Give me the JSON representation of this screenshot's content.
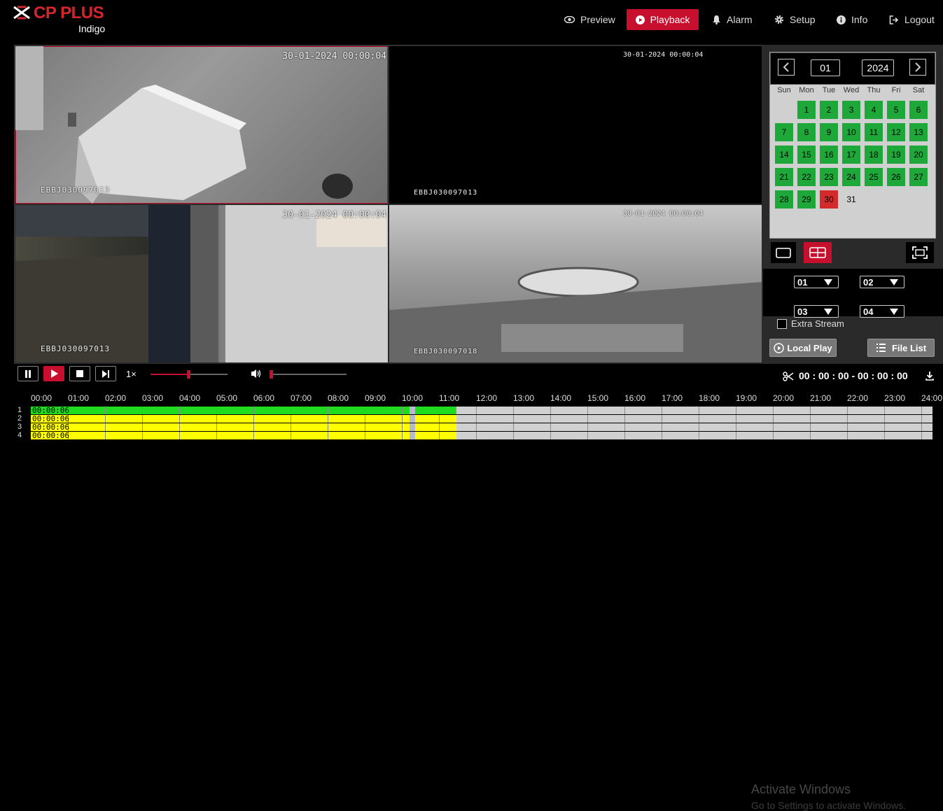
{
  "brand": {
    "name": "CP PLUS",
    "sub": "Indigo",
    "color": "#d6252f"
  },
  "nav": [
    {
      "label": "Preview",
      "icon": "eye-icon"
    },
    {
      "label": "Playback",
      "icon": "play-circle-icon",
      "active": true
    },
    {
      "label": "Alarm",
      "icon": "bell-icon"
    },
    {
      "label": "Setup",
      "icon": "gear-icon"
    },
    {
      "label": "Info",
      "icon": "info-icon"
    },
    {
      "label": "Logout",
      "icon": "logout-icon"
    }
  ],
  "tiles": [
    {
      "timestamp": "30-01-2024 00:00:04",
      "name": "EBBJ030097013",
      "selected": true
    },
    {
      "timestamp": "30-01-2024 00:00:04",
      "name": "EBBJ030097013"
    },
    {
      "timestamp": "30-01-2024 00:00:04",
      "name": "EBBJ030097013"
    },
    {
      "timestamp": "30-01-2024 00:00:04",
      "name": "EBBJ030097018"
    }
  ],
  "calendar": {
    "month": "01",
    "year": "2024",
    "weekdays": [
      "Sun",
      "Mon",
      "Tue",
      "Wed",
      "Thu",
      "Fri",
      "Sat"
    ],
    "days": [
      "1",
      "2",
      "3",
      "4",
      "5",
      "6",
      "7",
      "8",
      "9",
      "10",
      "11",
      "12",
      "13",
      "14",
      "15",
      "16",
      "17",
      "18",
      "19",
      "20",
      "21",
      "22",
      "23",
      "24",
      "25",
      "26",
      "27",
      "28",
      "29",
      "30",
      "31"
    ],
    "recorded_days": 29,
    "selected_day": "30",
    "colors": {
      "recorded": "#1fa83a",
      "selected": "#d32b2b"
    }
  },
  "channels": {
    "ch1": "01",
    "ch2": "02",
    "ch3": "03",
    "ch4": "04"
  },
  "extra_stream": {
    "label": "Extra Stream",
    "checked": false
  },
  "buttons": {
    "local_play": "Local Play",
    "file_list": "File List"
  },
  "controls": {
    "speed": "1×",
    "clip_time": "00 : 00 : 00 - 00 : 00 : 00"
  },
  "timeline": {
    "hours": [
      "00:00",
      "01:00",
      "02:00",
      "03:00",
      "04:00",
      "05:00",
      "06:00",
      "07:00",
      "08:00",
      "09:00",
      "10:00",
      "11:00",
      "12:00",
      "13:00",
      "14:00",
      "15:00",
      "16:00",
      "17:00",
      "18:00",
      "19:00",
      "20:00",
      "21:00",
      "22:00",
      "23:00",
      "24:00"
    ],
    "rows": [
      {
        "num": "1",
        "label": "00:00:06",
        "color": "#1fdc1f"
      },
      {
        "num": "2",
        "label": "00:00:06",
        "color": "#ffff00"
      },
      {
        "num": "3",
        "label": "00:00:06",
        "color": "#ffff00"
      },
      {
        "num": "4",
        "label": "00:00:06",
        "color": "#ffff00"
      }
    ]
  },
  "watermark": {
    "line1": "Activate Windows",
    "line2": "Go to Settings to activate Windows."
  }
}
